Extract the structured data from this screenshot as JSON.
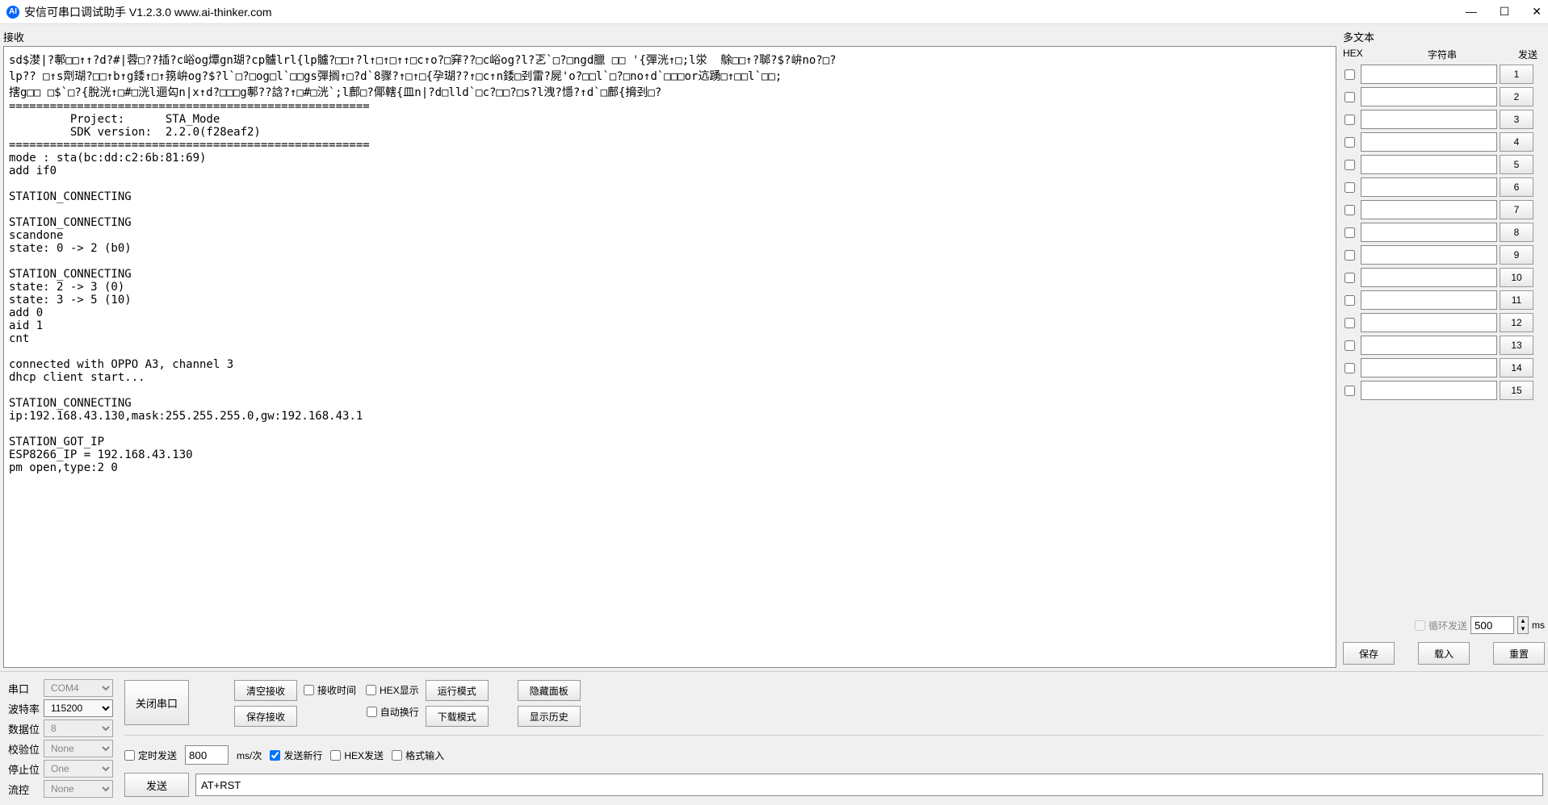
{
  "titlebar": {
    "logo": "AI",
    "title": "安信可串口调试助手 V1.2.3.0     www.ai-thinker.com",
    "min": "—",
    "max": "☐",
    "close": "✕"
  },
  "recv": {
    "label": "接收",
    "content": "sd$漤|?鄟□□↑↑?d?#|蓉□??插?c峪og燂gn瑚?cp髗lrl{lp髗?□□↑?l↑□↑□↑↑□c↑o?□穽??□c峪og?l?乤`□?□ngd臘 □□ '{彈洸↑□;l泶  鵌□□↑?郰?$?峅no?□?\nlp?? □↑s劑瑚?□□↑b↑g錗↑□↑箉峅og?$?l`□?□og□l`□□gs彈搁↑□?d`8骤?↑□↑□{孕瑚??↑□c↑n錗□刭雷?屍'o?□□l`□?□no↑d`□□□or迒踴□↑□□l`□□;\n搳g□□ □$`□?{脫洸↑□#□洸l逦匃n|x↑d?□□□g鄟??誝?↑□#□洸`;l鄜□?倻轄{皿n|?d□lld`□c?□□?□s?l洩?懚?↑d`□鄜{搚刭□?\n=====================================================\n         Project:      STA_Mode\n         SDK version:  2.2.0(f28eaf2)\n=====================================================\nmode : sta(bc:dd:c2:6b:81:69)\nadd if0\n\nSTATION_CONNECTING\n\nSTATION_CONNECTING\nscandone\nstate: 0 -> 2 (b0)\n\nSTATION_CONNECTING\nstate: 2 -> 3 (0)\nstate: 3 -> 5 (10)\nadd 0\naid 1\ncnt \n\nconnected with OPPO A3, channel 3\ndhcp client start...\n\nSTATION_CONNECTING\nip:192.168.43.130,mask:255.255.255.0,gw:192.168.43.1\n\nSTATION_GOT_IP\nESP8266_IP = 192.168.43.130\npm open,type:2 0"
  },
  "multi": {
    "label": "多文本",
    "header_hex": "HEX",
    "header_str": "字符串",
    "header_send": "发送",
    "rows": [
      {
        "n": "1"
      },
      {
        "n": "2"
      },
      {
        "n": "3"
      },
      {
        "n": "4"
      },
      {
        "n": "5"
      },
      {
        "n": "6"
      },
      {
        "n": "7"
      },
      {
        "n": "8"
      },
      {
        "n": "9"
      },
      {
        "n": "10"
      },
      {
        "n": "11"
      },
      {
        "n": "12"
      },
      {
        "n": "13"
      },
      {
        "n": "14"
      },
      {
        "n": "15"
      }
    ],
    "loop_label": "循环发送",
    "loop_value": "500",
    "loop_unit": "ms",
    "btn_save": "保存",
    "btn_load": "载入",
    "btn_reset": "重置"
  },
  "serial": {
    "port_label": "串口",
    "port_value": "COM4",
    "baud_label": "波特率",
    "baud_value": "115200",
    "data_label": "数据位",
    "data_value": "8",
    "parity_label": "校验位",
    "parity_value": "None",
    "stop_label": "停止位",
    "stop_value": "One",
    "flow_label": "流控",
    "flow_value": "None"
  },
  "controls": {
    "close_serial": "关闭串口",
    "clear_recv": "清空接收",
    "save_recv": "保存接收",
    "chk_recv_time": "接收时间",
    "chk_hex_disp": "HEX显示",
    "chk_auto_wrap": "自动换行",
    "run_mode": "运行模式",
    "download_mode": "下载模式",
    "hide_panel": "隐藏面板",
    "show_history": "显示历史"
  },
  "send": {
    "chk_timed": "定时发送",
    "timed_value": "800",
    "timed_unit": "ms/次",
    "chk_newline": "发送新行",
    "chk_hex_send": "HEX发送",
    "chk_format": "格式输入",
    "btn_send": "发送",
    "input_value": "AT+RST"
  }
}
